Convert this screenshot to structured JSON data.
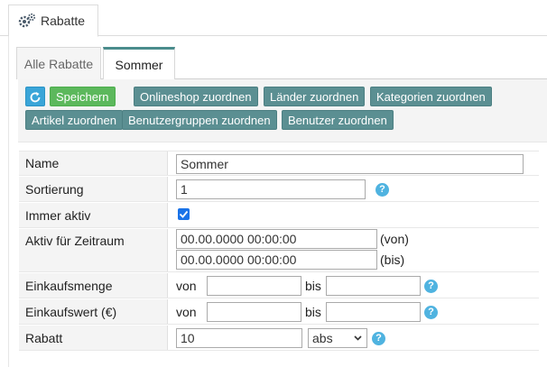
{
  "top_tab": {
    "label": "Rabatte",
    "icon": "gear-icon"
  },
  "sub_tabs": [
    {
      "label": "Alle Rabatte"
    },
    {
      "label": "Sommer"
    }
  ],
  "toolbar": {
    "refresh_icon": "refresh-icon",
    "save_label": "Speichern",
    "buttons": [
      "Onlineshop zuordnen",
      "Länder zuordnen",
      "Kategorien zuordnen",
      "Artikel zuordnen",
      "Benutzergruppen zuordnen",
      "Benutzer zuordnen"
    ]
  },
  "form": {
    "name": {
      "label": "Name",
      "value": "Sommer"
    },
    "sortierung": {
      "label": "Sortierung",
      "value": "1"
    },
    "immer_aktiv": {
      "label": "Immer aktiv",
      "checked": true
    },
    "zeitraum": {
      "label": "Aktiv für Zeitraum",
      "von_value": "00.00.0000 00:00:00",
      "von_suffix": "(von)",
      "bis_value": "00.00.0000 00:00:00",
      "bis_suffix": "(bis)"
    },
    "einkaufsmenge": {
      "label": "Einkaufsmenge",
      "von_label": "von",
      "bis_label": "bis",
      "von_value": "",
      "bis_value": ""
    },
    "einkaufswert": {
      "label": "Einkaufswert (€)",
      "von_label": "von",
      "bis_label": "bis",
      "von_value": "",
      "bis_value": ""
    },
    "rabatt": {
      "label": "Rabatt",
      "value": "10",
      "type_selected": "abs"
    },
    "help_icon": "?"
  },
  "colors": {
    "teal": "#5b8f92",
    "green": "#5cb85c",
    "blue": "#3aa5d8",
    "help": "#4fb3e0"
  }
}
